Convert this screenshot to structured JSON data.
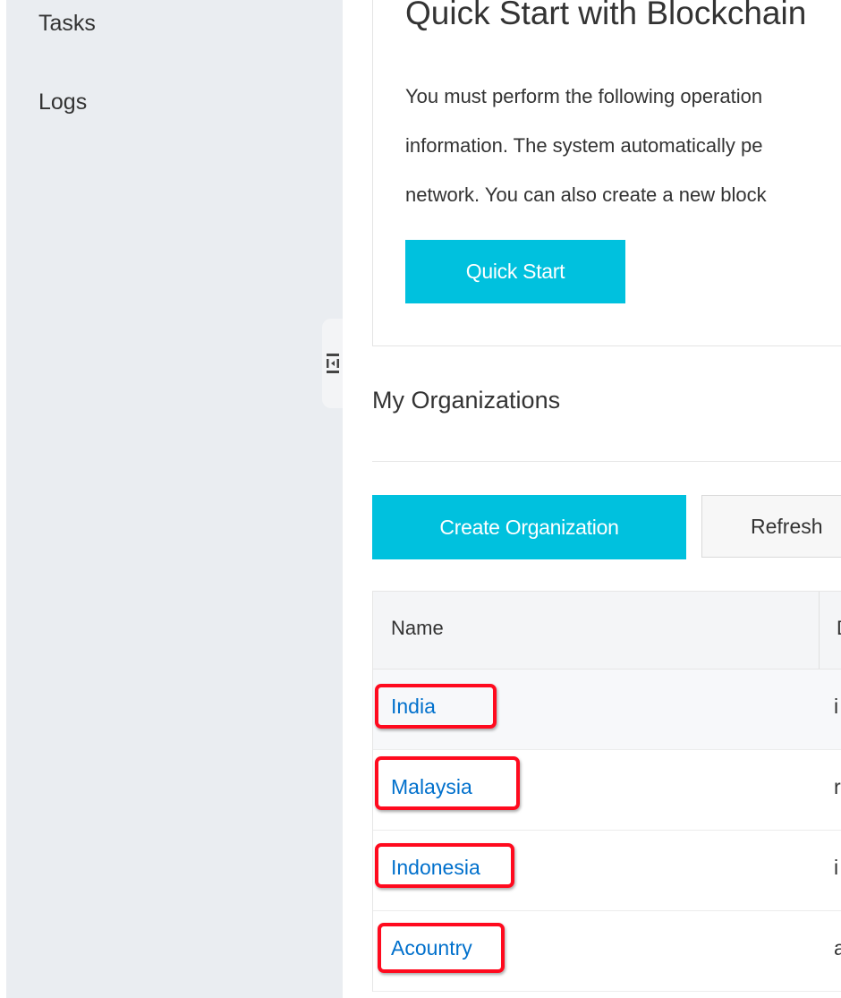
{
  "sidebar": {
    "items": [
      {
        "label": "Tasks"
      },
      {
        "label": "Logs"
      }
    ]
  },
  "collapse": {
    "icon": "collapse-sidebar-icon"
  },
  "quick_start": {
    "title": "Quick Start with Blockchain",
    "description": "You must perform the following operation\ninformation. The system automatically pe\nnetwork. You can also create a new block",
    "button_label": "Quick Start"
  },
  "organizations": {
    "title": "My Organizations",
    "create_label": "Create Organization",
    "refresh_label": "Refresh",
    "columns": [
      "Name",
      "D"
    ],
    "rows": [
      {
        "name": "India",
        "second": "i"
      },
      {
        "name": "Malaysia",
        "second": "r"
      },
      {
        "name": "Indonesia",
        "second": "i"
      },
      {
        "name": "Acountry",
        "second": "a"
      }
    ]
  },
  "colors": {
    "accent": "#00c1de",
    "link": "#0070cc",
    "highlight": "#ff0a1e",
    "sidebar_bg": "#eaedf1"
  }
}
